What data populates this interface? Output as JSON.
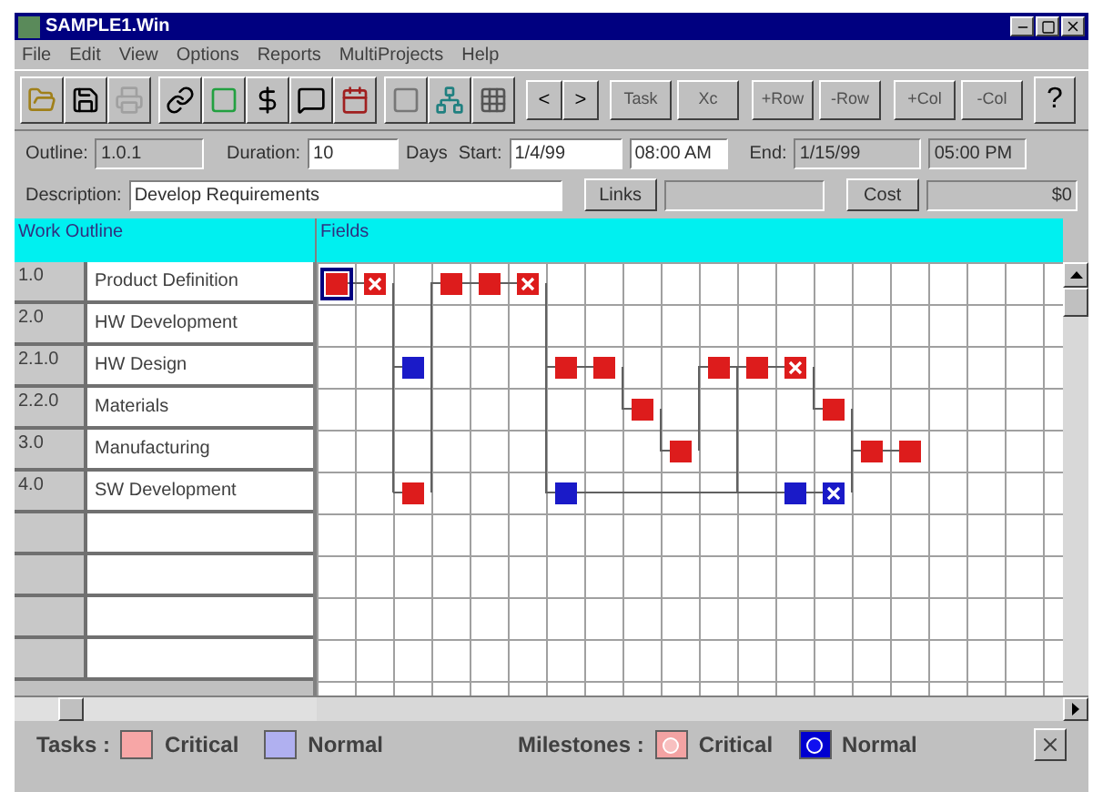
{
  "window": {
    "title": "SAMPLE1.Win"
  },
  "menu": [
    "File",
    "Edit",
    "View",
    "Options",
    "Reports",
    "MultiProjects",
    "Help"
  ],
  "toolbar": {
    "icon_buttons": [
      {
        "kind": "open",
        "disabled": false
      },
      {
        "kind": "save",
        "disabled": false
      },
      {
        "kind": "print",
        "disabled": true
      },
      {
        "kind": "link",
        "disabled": false
      },
      {
        "kind": "page",
        "disabled": false
      },
      {
        "kind": "dollar",
        "disabled": false
      },
      {
        "kind": "note",
        "disabled": false
      },
      {
        "kind": "calendar",
        "disabled": false
      },
      {
        "kind": "blank",
        "disabled": false
      },
      {
        "kind": "network",
        "disabled": false
      },
      {
        "kind": "grid",
        "disabled": false
      }
    ],
    "nav_buttons": [
      "<",
      ">"
    ],
    "text_buttons": [
      "Task",
      "Xc",
      "+Row",
      "-Row",
      "+Col",
      "-Col"
    ],
    "help_button": "?"
  },
  "fields": {
    "outline_label": "Outline:",
    "outline": "1.0.1",
    "duration_label": "Duration:",
    "duration": "10",
    "days_label": "Days",
    "start_label": "Start:",
    "start_date": "1/4/99",
    "start_time": "08:00 AM",
    "end_label": "End:",
    "end_date": "1/15/99",
    "end_time": "05:00 PM",
    "description_label": "Description:",
    "description": "Develop Requirements",
    "links_button": "Links",
    "cost_button": "Cost",
    "cost": "$0"
  },
  "outline": {
    "header": "Work Outline",
    "rows": [
      {
        "number": "1.0",
        "name": "Product Definition"
      },
      {
        "number": "2.0",
        "name": "HW Development"
      },
      {
        "number": "2.1.0",
        "name": "HW Design"
      },
      {
        "number": "2.2.0",
        "name": "Materials"
      },
      {
        "number": "3.0",
        "name": "Manufacturing"
      },
      {
        "number": "4.0",
        "name": "SW Development"
      }
    ]
  },
  "chart": {
    "header": "Fields",
    "nodes": [
      {
        "kind": "critical_task",
        "selected": true
      },
      {
        "kind": "critical_milestone",
        "selected": false
      },
      {
        "kind": "critical_task",
        "selected": false
      },
      {
        "kind": "critical_task",
        "selected": false
      },
      {
        "kind": "critical_milestone",
        "selected": false
      },
      {
        "kind": "normal_task",
        "selected": false
      },
      {
        "kind": "critical_task",
        "selected": false
      },
      {
        "kind": "critical_task",
        "selected": false
      },
      {
        "kind": "critical_task",
        "selected": false
      },
      {
        "kind": "critical_task",
        "selected": false
      },
      {
        "kind": "critical_milestone",
        "selected": false
      },
      {
        "kind": "critical_task",
        "selected": false
      },
      {
        "kind": "critical_task",
        "selected": false
      },
      {
        "kind": "critical_task",
        "selected": false
      },
      {
        "kind": "critical_task",
        "selected": false
      },
      {
        "kind": "critical_task",
        "selected": false
      },
      {
        "kind": "critical_task",
        "selected": false
      },
      {
        "kind": "normal_task",
        "selected": false
      },
      {
        "kind": "normal_task",
        "selected": false
      },
      {
        "kind": "normal_milestone",
        "selected": false
      }
    ]
  },
  "legend": {
    "tasks_label": "Tasks :",
    "milestones_label": "Milestones :",
    "tasks": [
      {
        "kind": "critical_task",
        "label": "Critical"
      },
      {
        "kind": "normal_task",
        "label": "Normal"
      }
    ],
    "milestones": [
      {
        "kind": "critical_milestone",
        "label": "Critical"
      },
      {
        "kind": "normal_milestone",
        "label": "Normal"
      }
    ]
  }
}
